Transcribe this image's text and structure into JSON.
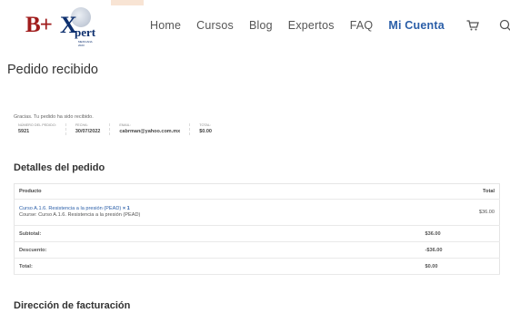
{
  "header": {
    "logo": {
      "b": "B+",
      "x": "X",
      "pert": "pert",
      "tagline": "MEXICANA 2023"
    },
    "nav": [
      {
        "label": "Home",
        "active": false
      },
      {
        "label": "Cursos",
        "active": false
      },
      {
        "label": "Blog",
        "active": false
      },
      {
        "label": "Expertos",
        "active": false
      },
      {
        "label": "FAQ",
        "active": false
      },
      {
        "label": "Mi Cuenta",
        "active": true
      }
    ]
  },
  "page": {
    "title": "Pedido recibido"
  },
  "order": {
    "thanks": "Gracias. Tu pedido ha sido recibido.",
    "overview": [
      {
        "label": "Número del pedido:",
        "value": "5921"
      },
      {
        "label": "Fecha:",
        "value": "30/07/2022"
      },
      {
        "label": "Email:",
        "value": "cabrman@yahoo.com.mx"
      },
      {
        "label": "Total:",
        "value": "$0.00"
      }
    ]
  },
  "details": {
    "title": "Detalles del pedido",
    "columns": {
      "product": "Producto",
      "total": "Total"
    },
    "item": {
      "name": "Curso A.1.6. Resistencia a la presión (PEAD)",
      "qty": "× 1",
      "meta": "Course: Curso A.1.6. Resistencia a la presión (PEAD)",
      "total": "$36.00"
    },
    "summary": [
      {
        "label": "Subtotal:",
        "value": "$36.00"
      },
      {
        "label": "Descuento:",
        "value": "-$36.00"
      },
      {
        "label": "Total:",
        "value": "$0.00"
      }
    ]
  },
  "billing": {
    "title": "Dirección de facturación"
  },
  "colors": {
    "accent": "#2a5ea8",
    "brand_red": "#a01c1c",
    "brand_navy": "#0d2f6e"
  },
  "icons": {
    "cart": "cart-icon",
    "search": "search-icon"
  }
}
